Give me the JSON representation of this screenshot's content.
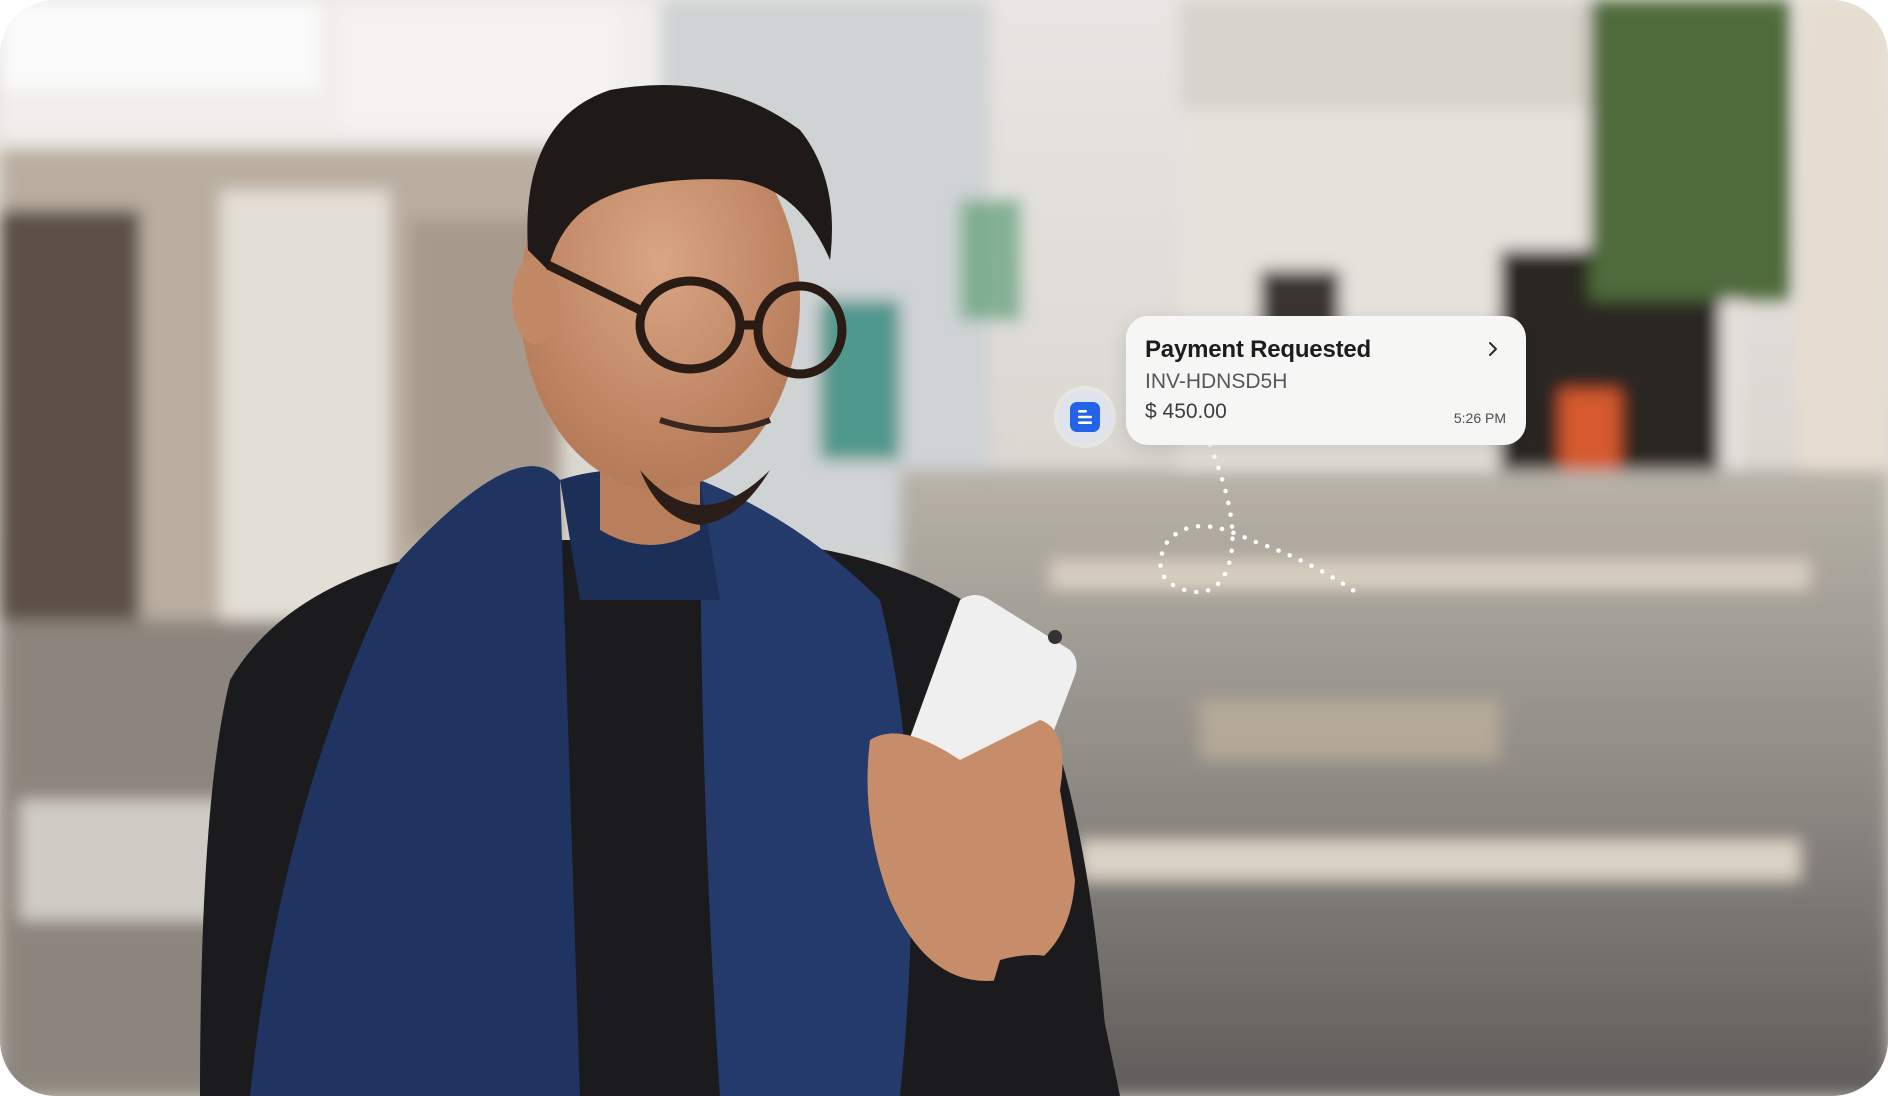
{
  "scene": {
    "description_icon": "person-with-phone-photo"
  },
  "notification": {
    "title": "Payment Requested",
    "invoice_id": "INV-HDNSD5H",
    "amount": "$ 450.00",
    "time": "5:26 PM",
    "chevron_icon": "chevron-right-icon",
    "app_icon": "document-icon",
    "accent_color": "#2363e8"
  }
}
